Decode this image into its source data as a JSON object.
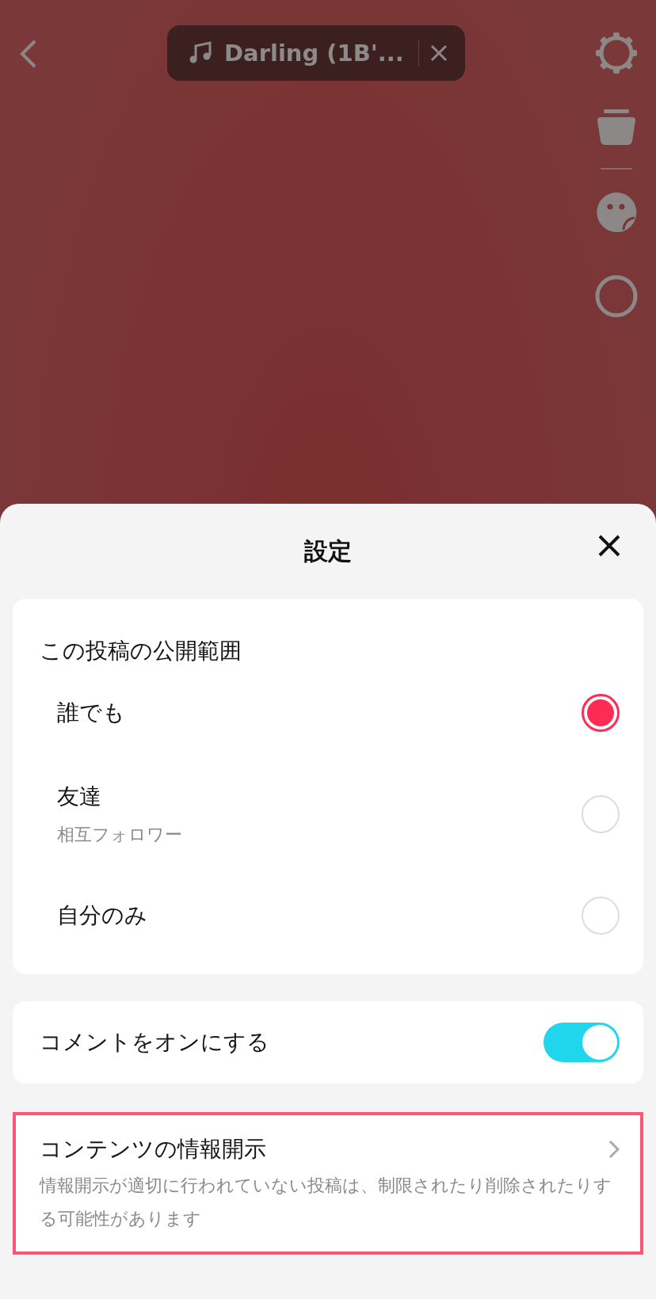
{
  "music_pill": {
    "title": "Darling (1B'..."
  },
  "sheet": {
    "title": "設定",
    "visibility": {
      "heading": "この投稿の公開範囲",
      "options": [
        {
          "label": "誰でも",
          "selected": true
        },
        {
          "label": "友達",
          "sublabel": "相互フォロワー",
          "selected": false
        },
        {
          "label": "自分のみ",
          "selected": false
        }
      ]
    },
    "comments": {
      "label": "コメントをオンにする",
      "on": true
    },
    "disclosure": {
      "title": "コンテンツの情報開示",
      "description": "情報開示が適切に行われていない投稿は、制限されたり削除されたりする可能性があります",
      "highlighted": true
    }
  }
}
